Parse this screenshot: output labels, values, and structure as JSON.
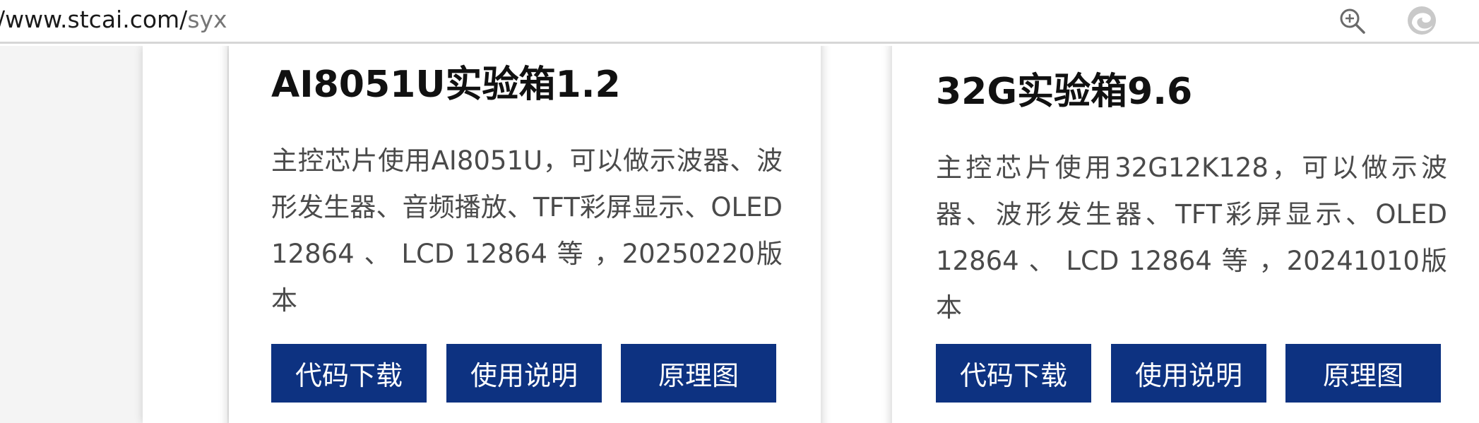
{
  "address_bar": {
    "url_domain": "/www.stcai.com/",
    "url_path": "syx",
    "zoom_icon": "zoom-in-icon",
    "extension_icon": "extension-icon"
  },
  "cards": [
    {
      "title": "AI8051U实验箱1.2",
      "description": "主控芯片使用AI8051U，可以做示波器、波形发生器、音频播放、TFT彩屏显示、OLED 12864 、 LCD 12864 等 ，20250220版本",
      "buttons": {
        "code": "代码下载",
        "manual": "使用说明",
        "schematic": "原理图"
      }
    },
    {
      "title": "32G实验箱9.6",
      "description": "主控芯片使用32G12K128，可以做示波器、波形发生器、TFT彩屏显示、OLED 12864 、 LCD 12864 等 ，20241010版本",
      "buttons": {
        "code": "代码下载",
        "manual": "使用说明",
        "schematic": "原理图"
      }
    }
  ],
  "colors": {
    "button_bg": "#0d3281",
    "button_text": "#ffffff",
    "title_text": "#111111",
    "desc_text": "#4a4a4a"
  }
}
